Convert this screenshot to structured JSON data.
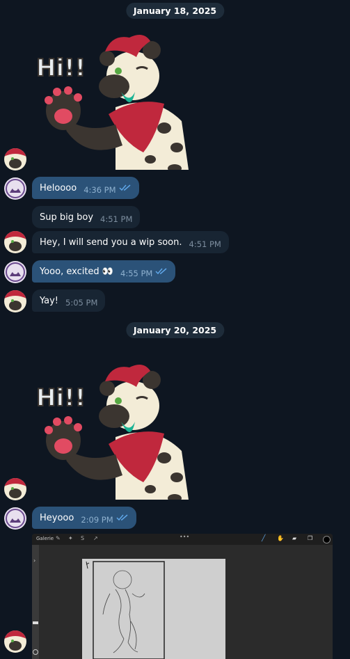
{
  "dates": [
    "January 18, 2025",
    "January 20, 2025"
  ],
  "sticker": {
    "text": "Hi!!"
  },
  "messages": [
    {
      "text": "Heloooo",
      "time": "4:36 PM",
      "side": "out",
      "read": true
    },
    {
      "text": "Sup big boy",
      "time": "4:51 PM",
      "side": "in"
    },
    {
      "text": "Hey, I will send you a wip soon.",
      "time": "4:51 PM",
      "side": "in"
    },
    {
      "text": "Yooo, excited 👀",
      "time": "4:55 PM",
      "side": "out",
      "read": true
    },
    {
      "text": "Yay!",
      "time": "5:05 PM",
      "side": "in"
    },
    {
      "text": "Heyooo",
      "time": "2:09 PM",
      "side": "out",
      "read": true
    }
  ],
  "image_toolbar": {
    "gallery_label": "Galerie"
  },
  "colors": {
    "background": "#0e1621",
    "incoming_bubble": "#182533",
    "outgoing_bubble": "#2b5278",
    "date_pill": "#1e2c3a",
    "check_marks": "#5fa6e8"
  }
}
